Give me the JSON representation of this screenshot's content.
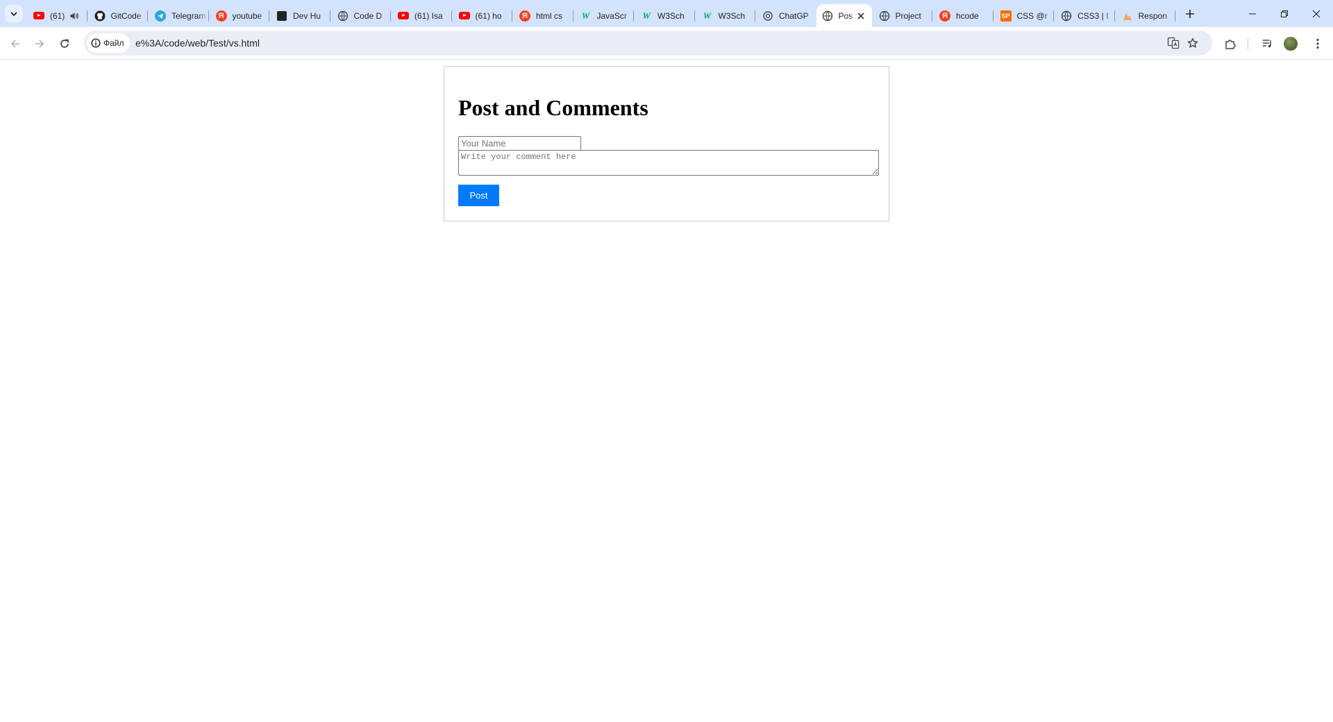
{
  "browser": {
    "tabs": [
      {
        "title": "(61)",
        "icon": "youtube-icon",
        "audio": true
      },
      {
        "title": "GitCode",
        "icon": "github-icon"
      },
      {
        "title": "Telegram",
        "icon": "telegram-icon"
      },
      {
        "title": "youtube",
        "icon": "yandex-icon"
      },
      {
        "title": "Dev Hu",
        "icon": "devhub-icon"
      },
      {
        "title": "Code D",
        "icon": "globe-icon"
      },
      {
        "title": "(61) Isa",
        "icon": "youtube-icon"
      },
      {
        "title": "(61) ho",
        "icon": "youtube-icon"
      },
      {
        "title": "html cs",
        "icon": "yandex-icon"
      },
      {
        "title": "JavaScr",
        "icon": "w3schools-icon"
      },
      {
        "title": "W3Sch",
        "icon": "w3schools-icon"
      },
      {
        "title": "W3Sch",
        "icon": "w3schools-icon"
      },
      {
        "title": "ChatGP",
        "icon": "openai-icon"
      },
      {
        "title": "Pos",
        "icon": "globe-icon",
        "active": true
      },
      {
        "title": "Project",
        "icon": "globe-icon"
      },
      {
        "title": "hcode",
        "icon": "yandex-icon"
      },
      {
        "title": "CSS @r",
        "icon": "sitepoint-icon"
      },
      {
        "title": "CSS3 | I",
        "icon": "globe-icon"
      },
      {
        "title": "Respon",
        "icon": "sketch-icon"
      }
    ],
    "omnibox": {
      "chip_label": "Файл",
      "url": "e%3A/code/web/Test/vs.html"
    }
  },
  "page": {
    "title": "Post and Comments",
    "name_placeholder": "Your Name",
    "comment_placeholder": "Write your comment here",
    "post_label": "Post",
    "accent_color": "#007bff"
  }
}
